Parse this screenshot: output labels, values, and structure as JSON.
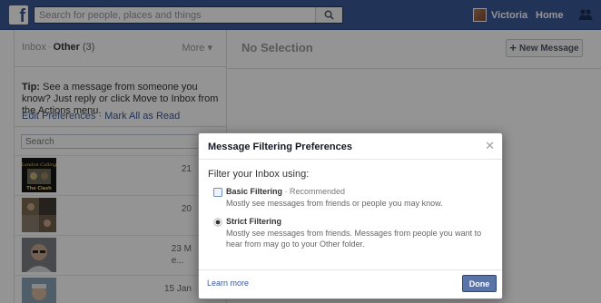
{
  "topbar": {
    "logo": "f",
    "search_placeholder": "Search for people, places and things",
    "user_name": "Victoria",
    "home_label": "Home"
  },
  "left": {
    "tab_inbox": "Inbox",
    "tab_other": "Other",
    "tab_other_count": "(3)",
    "more_label": "More",
    "tip_label": "Tip:",
    "tip_text": " See a message from someone you know? Just reply or click Move to Inbox from the Actions menu.",
    "edit_preferences": "Edit Preferences",
    "mark_all_read": "Mark All as Read",
    "search_placeholder": "Search",
    "threads": [
      {
        "date_line1": "21",
        "date_line2": ""
      },
      {
        "date_line1": "20",
        "date_line2": ""
      },
      {
        "date_line1": "23 M",
        "date_line2": "e..."
      },
      {
        "date_line1": "15 Jan",
        "date_line2": ""
      }
    ]
  },
  "right": {
    "header": "No Selection",
    "new_message": "New Message"
  },
  "dialog": {
    "title": "Message Filtering Preferences",
    "prompt": "Filter your Inbox using:",
    "basic_title": "Basic Filtering",
    "basic_sep": " · ",
    "basic_recommended": "Recommended",
    "basic_desc": "Mostly see messages from friends or people you may know.",
    "strict_title": "Strict Filtering",
    "strict_desc": "Mostly see messages from friends. Messages from people you want to hear from may go to your Other folder.",
    "learn_more": "Learn more",
    "done": "Done",
    "selected_option": "strict"
  },
  "colors": {
    "brand_blue": "#3b5998",
    "done_button": "#5b74a8"
  }
}
